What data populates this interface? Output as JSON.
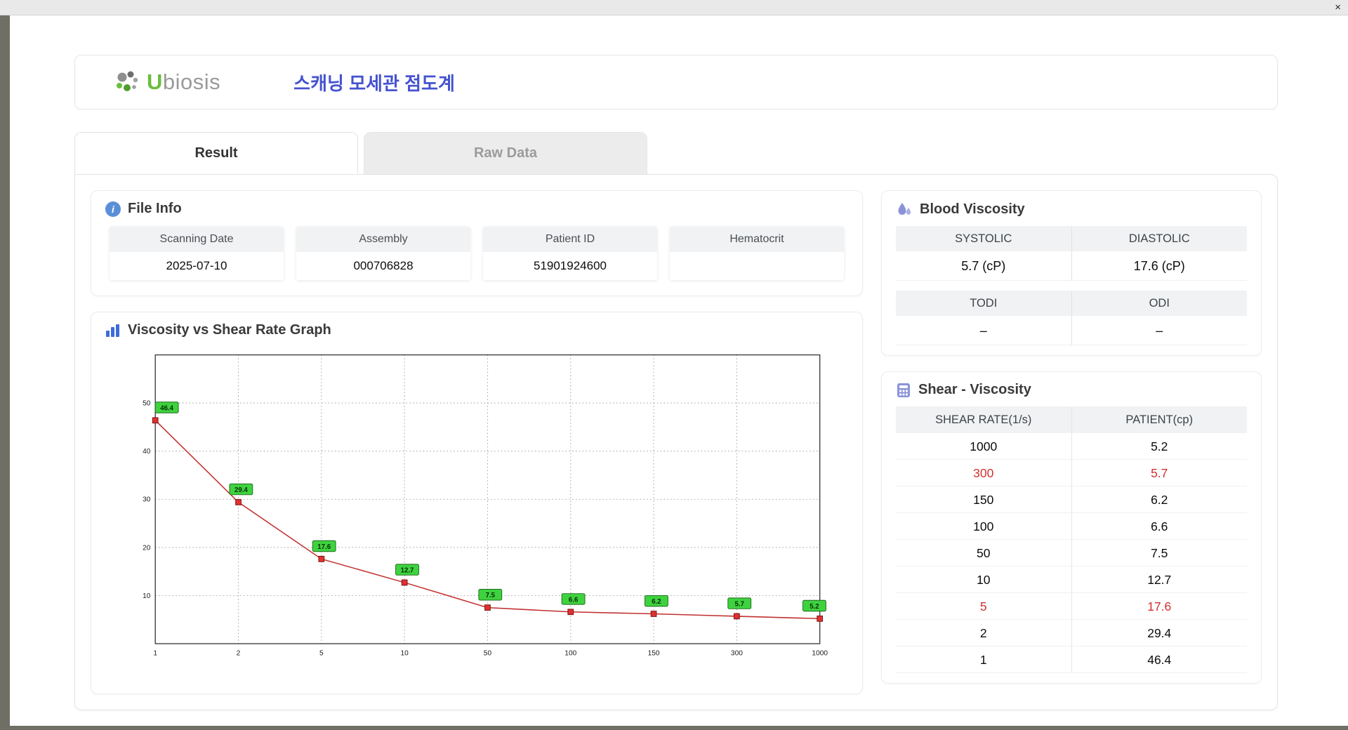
{
  "window": {
    "close_label": "×"
  },
  "header": {
    "brand_u": "U",
    "brand_rest": "biosis",
    "title": "스캐닝 모세관 점도계"
  },
  "tabs": [
    {
      "label": "Result"
    },
    {
      "label": "Raw Data"
    }
  ],
  "file_info": {
    "title": "File Info",
    "fields": [
      {
        "label": "Scanning Date",
        "value": "2025-07-10"
      },
      {
        "label": "Assembly",
        "value": "000706828"
      },
      {
        "label": "Patient ID",
        "value": "51901924600"
      },
      {
        "label": "Hematocrit",
        "value": ""
      }
    ]
  },
  "graph": {
    "title": "Viscosity vs Shear Rate Graph"
  },
  "blood_viscosity": {
    "title": "Blood Viscosity",
    "systolic_label": "SYSTOLIC",
    "diastolic_label": "DIASTOLIC",
    "systolic_value": "5.7 (cP)",
    "diastolic_value": "17.6 (cP)",
    "todi_label": "TODI",
    "odi_label": "ODI",
    "todi_value": "–",
    "odi_value": "–"
  },
  "shear_viscosity": {
    "title": "Shear - Viscosity",
    "col_shear": "SHEAR RATE(1/s)",
    "col_patient": "PATIENT(cp)",
    "rows": [
      {
        "shear": "1000",
        "patient": "5.2"
      },
      {
        "shear": "300",
        "patient": "5.7"
      },
      {
        "shear": "150",
        "patient": "6.2"
      },
      {
        "shear": "100",
        "patient": "6.6"
      },
      {
        "shear": "50",
        "patient": "7.5"
      },
      {
        "shear": "10",
        "patient": "12.7"
      },
      {
        "shear": "5",
        "patient": "17.6"
      },
      {
        "shear": "2",
        "patient": "29.4"
      },
      {
        "shear": "1",
        "patient": "46.4"
      }
    ]
  },
  "chart_data": {
    "type": "line",
    "title": "Viscosity vs Shear Rate Graph",
    "x_ticks": [
      "1",
      "2",
      "5",
      "10",
      "50",
      "100",
      "150",
      "300",
      "1000"
    ],
    "values": [
      46.4,
      29.4,
      17.6,
      12.7,
      7.5,
      6.6,
      6.2,
      5.7,
      5.2
    ],
    "y_ticks": [
      10,
      20,
      30,
      40,
      50
    ],
    "ylim": [
      0,
      60
    ],
    "xlabel": "",
    "ylabel": "",
    "x_scale": "log-like ticks, evenly spaced",
    "grid": "dotted",
    "line_color": "#c13030",
    "marker_color": "#e03131",
    "label_fill": "#3fd23f",
    "label_border": "#1d6b1d"
  }
}
